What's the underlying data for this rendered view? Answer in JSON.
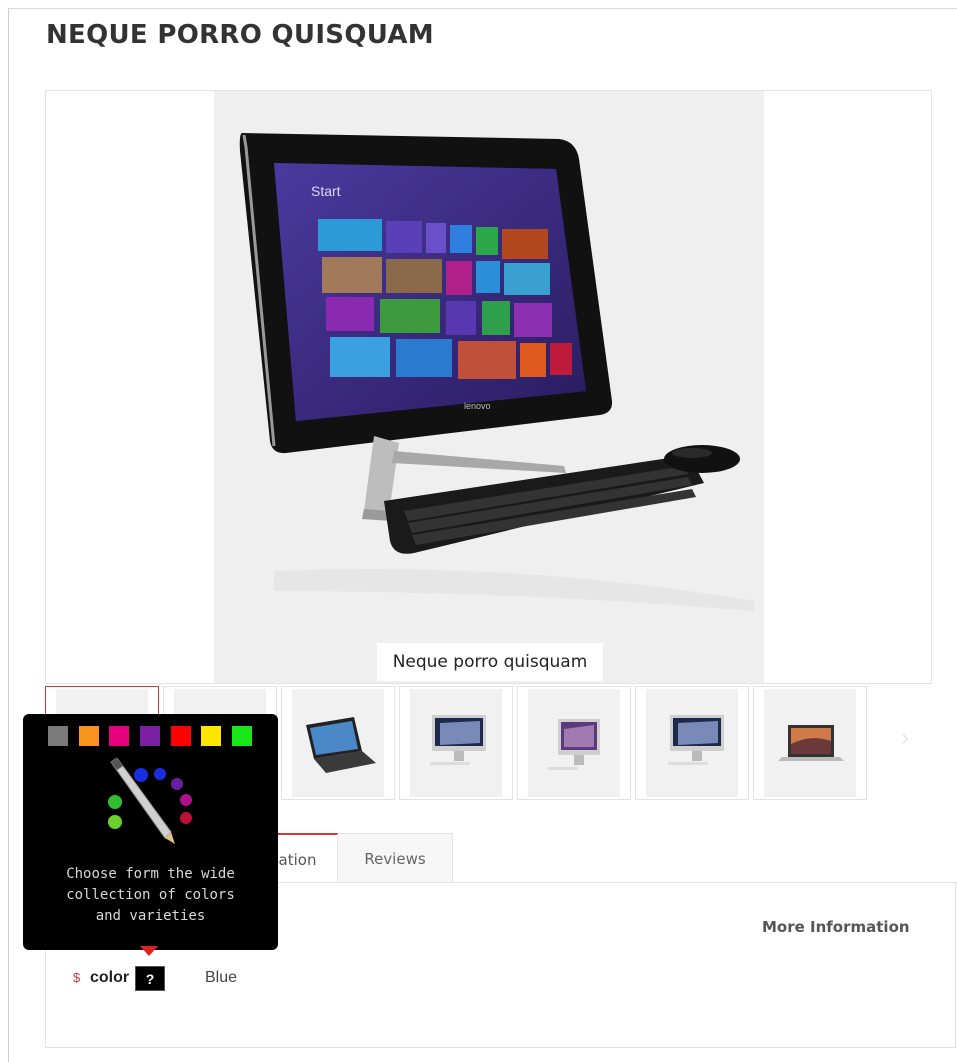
{
  "product": {
    "title": "NEQUE PORRO QUISQUAM",
    "image_caption": "Neque porro quisquam"
  },
  "screen_text": {
    "start": "Start",
    "brand": "lenovo"
  },
  "thumbnails": [
    {
      "name": "thumb-1",
      "active": true,
      "icon": "all-in-one-pc"
    },
    {
      "name": "thumb-2",
      "active": false,
      "icon": "all-in-one-pc"
    },
    {
      "name": "thumb-3",
      "active": false,
      "icon": "laptop-icon"
    },
    {
      "name": "thumb-4",
      "active": false,
      "icon": "imac-icon"
    },
    {
      "name": "thumb-5",
      "active": false,
      "icon": "imac-icon"
    },
    {
      "name": "thumb-6",
      "active": false,
      "icon": "imac-icon"
    },
    {
      "name": "thumb-7",
      "active": false,
      "icon": "macbook-icon"
    }
  ],
  "tabs": {
    "info_label": "ation",
    "reviews_label": "Reviews"
  },
  "more_information": {
    "heading": "More Information",
    "required_mark": "$",
    "attribute_label": "color",
    "help_label": "?",
    "attribute_value": "Blue"
  },
  "tooltip": {
    "line1": "Choose form the wide",
    "line2": "collection of colors",
    "line3": "and varieties",
    "swatches": [
      "#7a7a7a",
      "#f7931e",
      "#e6007e",
      "#7a1fa2",
      "#ff0000",
      "#ffe600",
      "#19e619"
    ],
    "icon": "color-palette-pen-icon"
  },
  "colors": {
    "accent": "#d23a3a",
    "tooltip_bg": "#000000"
  }
}
